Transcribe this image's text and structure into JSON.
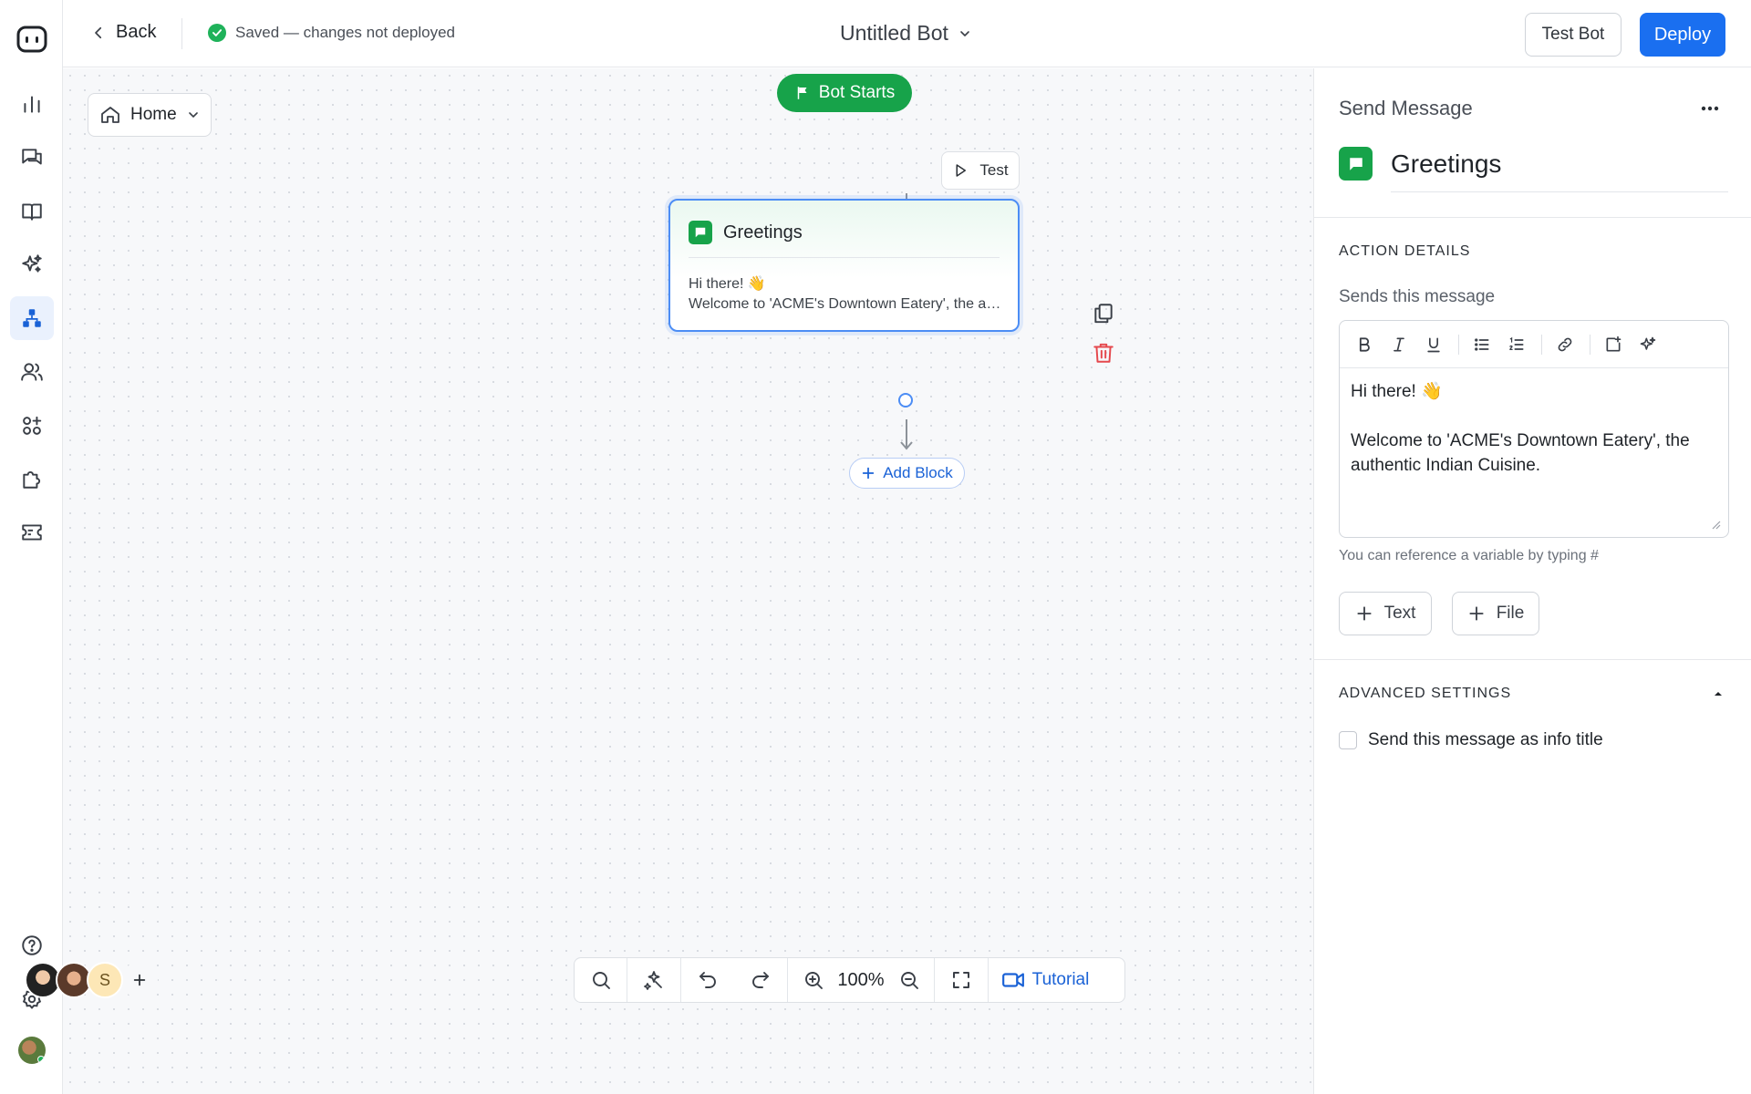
{
  "colors": {
    "accent": "#1a6ff0",
    "success": "#17a34a",
    "danger": "#e5484d",
    "node_border": "#4c8df5"
  },
  "rail": {
    "logo": "bot-logo-icon",
    "items": [
      {
        "icon": "analytics-icon",
        "active": false
      },
      {
        "icon": "conversations-icon",
        "active": false
      },
      {
        "icon": "knowledge-book-icon",
        "active": false
      },
      {
        "icon": "ai-sparkle-icon",
        "active": false
      },
      {
        "icon": "flow-builder-icon",
        "active": true
      },
      {
        "icon": "users-icon",
        "active": false
      },
      {
        "icon": "integrations-icon",
        "active": false
      },
      {
        "icon": "plugins-icon",
        "active": false
      },
      {
        "icon": "tickets-icon",
        "active": false
      }
    ],
    "bottom": [
      "help-icon",
      "settings-icon",
      "user-avatar"
    ]
  },
  "topbar": {
    "back_label": "Back",
    "status": "Saved — changes not deployed",
    "bot_name": "Untitled Bot",
    "test_bot_label": "Test Bot",
    "deploy_label": "Deploy"
  },
  "canvas": {
    "home_dropdown": "Home",
    "start_label": "Bot Starts",
    "test_chip": "Test",
    "node": {
      "title": "Greetings",
      "line1": "Hi there! 👋",
      "line2": "Welcome to 'ACME's Downtown Eatery', the authentic Indian Cuisine."
    },
    "add_block_label": "Add Block",
    "collaborators": [
      "",
      "",
      "S"
    ],
    "zoom": "100%",
    "tutorial_label": "Tutorial"
  },
  "panel": {
    "type_label": "Send Message",
    "name": "Greetings",
    "action_details_heading": "ACTION DETAILS",
    "field_label": "Sends this message",
    "message_line1": "Hi there! 👋",
    "message_line2": "Welcome to 'ACME's Downtown Eatery', the authentic Indian Cuisine.",
    "hint": "You can reference a variable by typing #",
    "add_text_label": "Text",
    "add_file_label": "File",
    "advanced_heading": "ADVANCED SETTINGS",
    "info_title_checkbox_label": "Send this message as info title",
    "info_title_checked": false
  }
}
